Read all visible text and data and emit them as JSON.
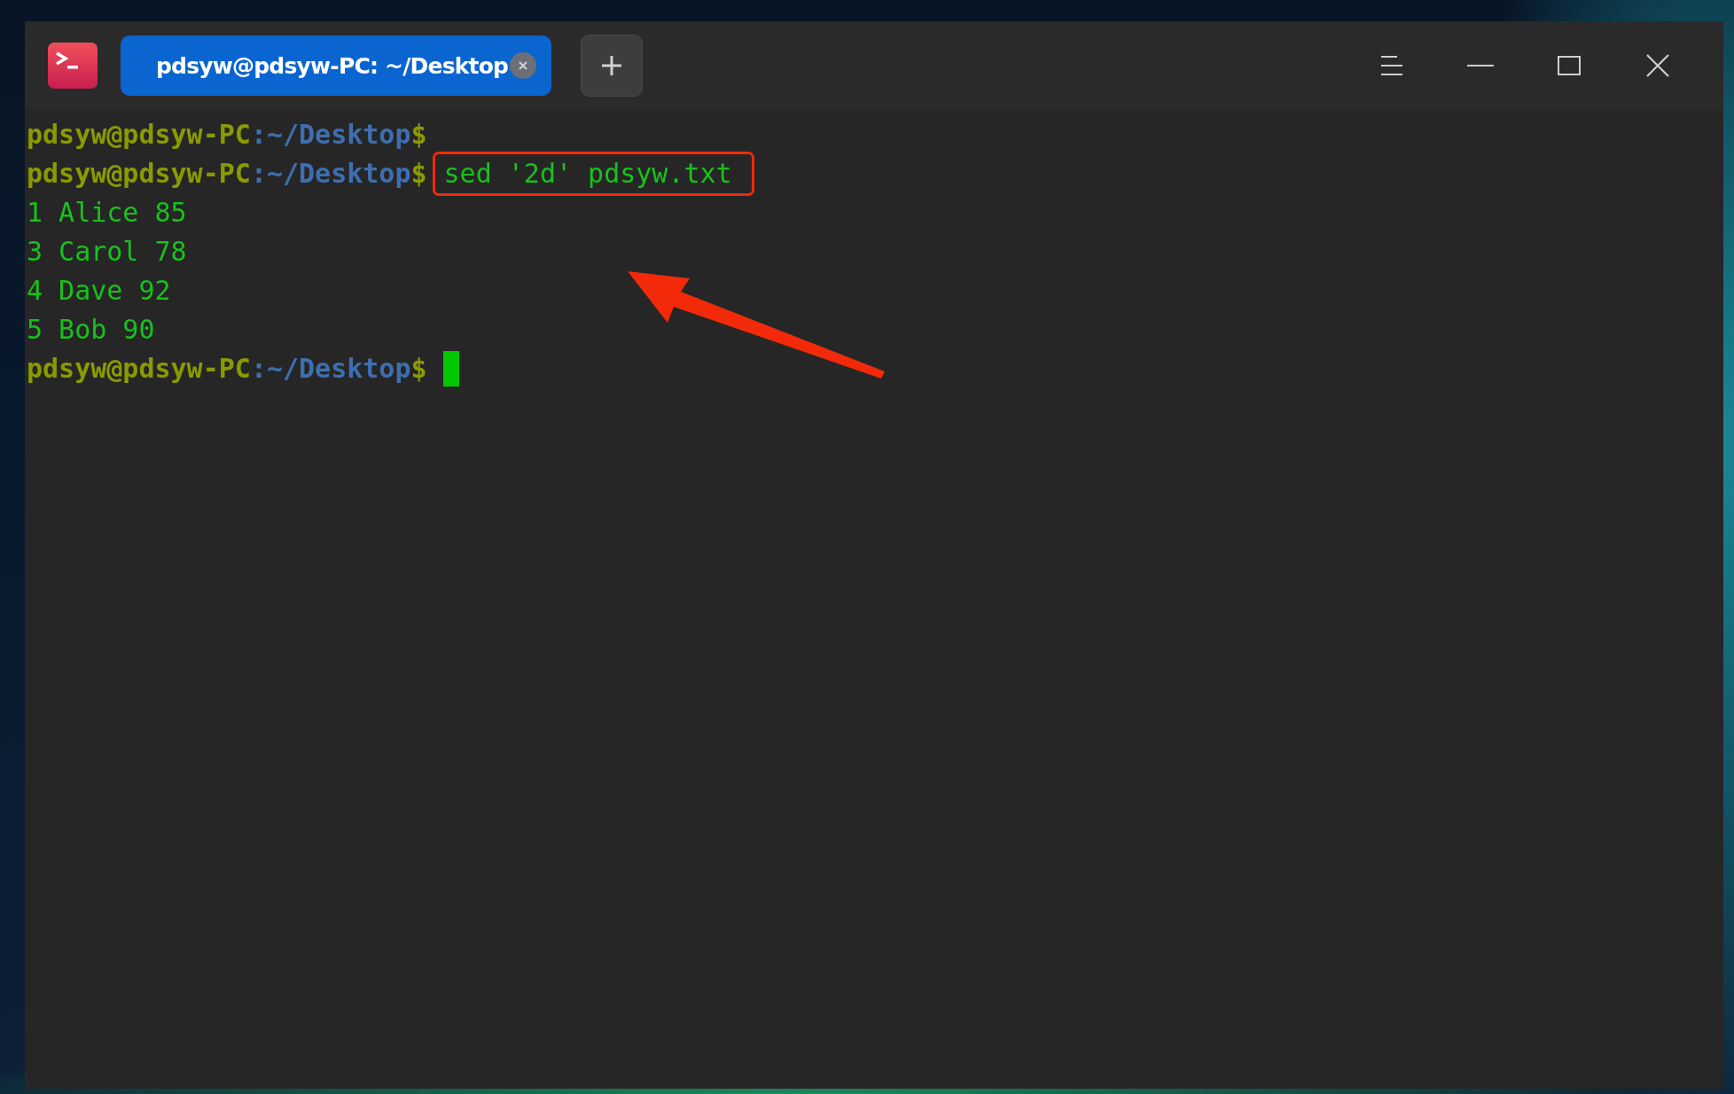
{
  "window": {
    "tab": {
      "title": "pdsyw@pdsyw-PC: ~/Desktop",
      "selected": true
    }
  },
  "terminal": {
    "lines": [
      {
        "kind": "prompt",
        "user": "pdsyw@pdsyw-PC",
        "separator": ":",
        "path": "~/Desktop",
        "sigil": "$",
        "highlighted": false,
        "cursor": false
      },
      {
        "kind": "prompt",
        "user": "pdsyw@pdsyw-PC",
        "separator": ":",
        "path": "~/Desktop",
        "sigil": "$",
        "command": "sed '2d' pdsyw.txt",
        "highlighted": true,
        "cursor": false
      },
      {
        "kind": "output",
        "text": "1 Alice 85"
      },
      {
        "kind": "output",
        "text": "3 Carol 78"
      },
      {
        "kind": "output",
        "text": "4 Dave 92"
      },
      {
        "kind": "output",
        "text": "5 Bob 90"
      },
      {
        "kind": "prompt",
        "user": "pdsyw@pdsyw-PC",
        "separator": ":",
        "path": "~/Desktop",
        "sigil": "$",
        "highlighted": false,
        "cursor": true
      }
    ]
  }
}
